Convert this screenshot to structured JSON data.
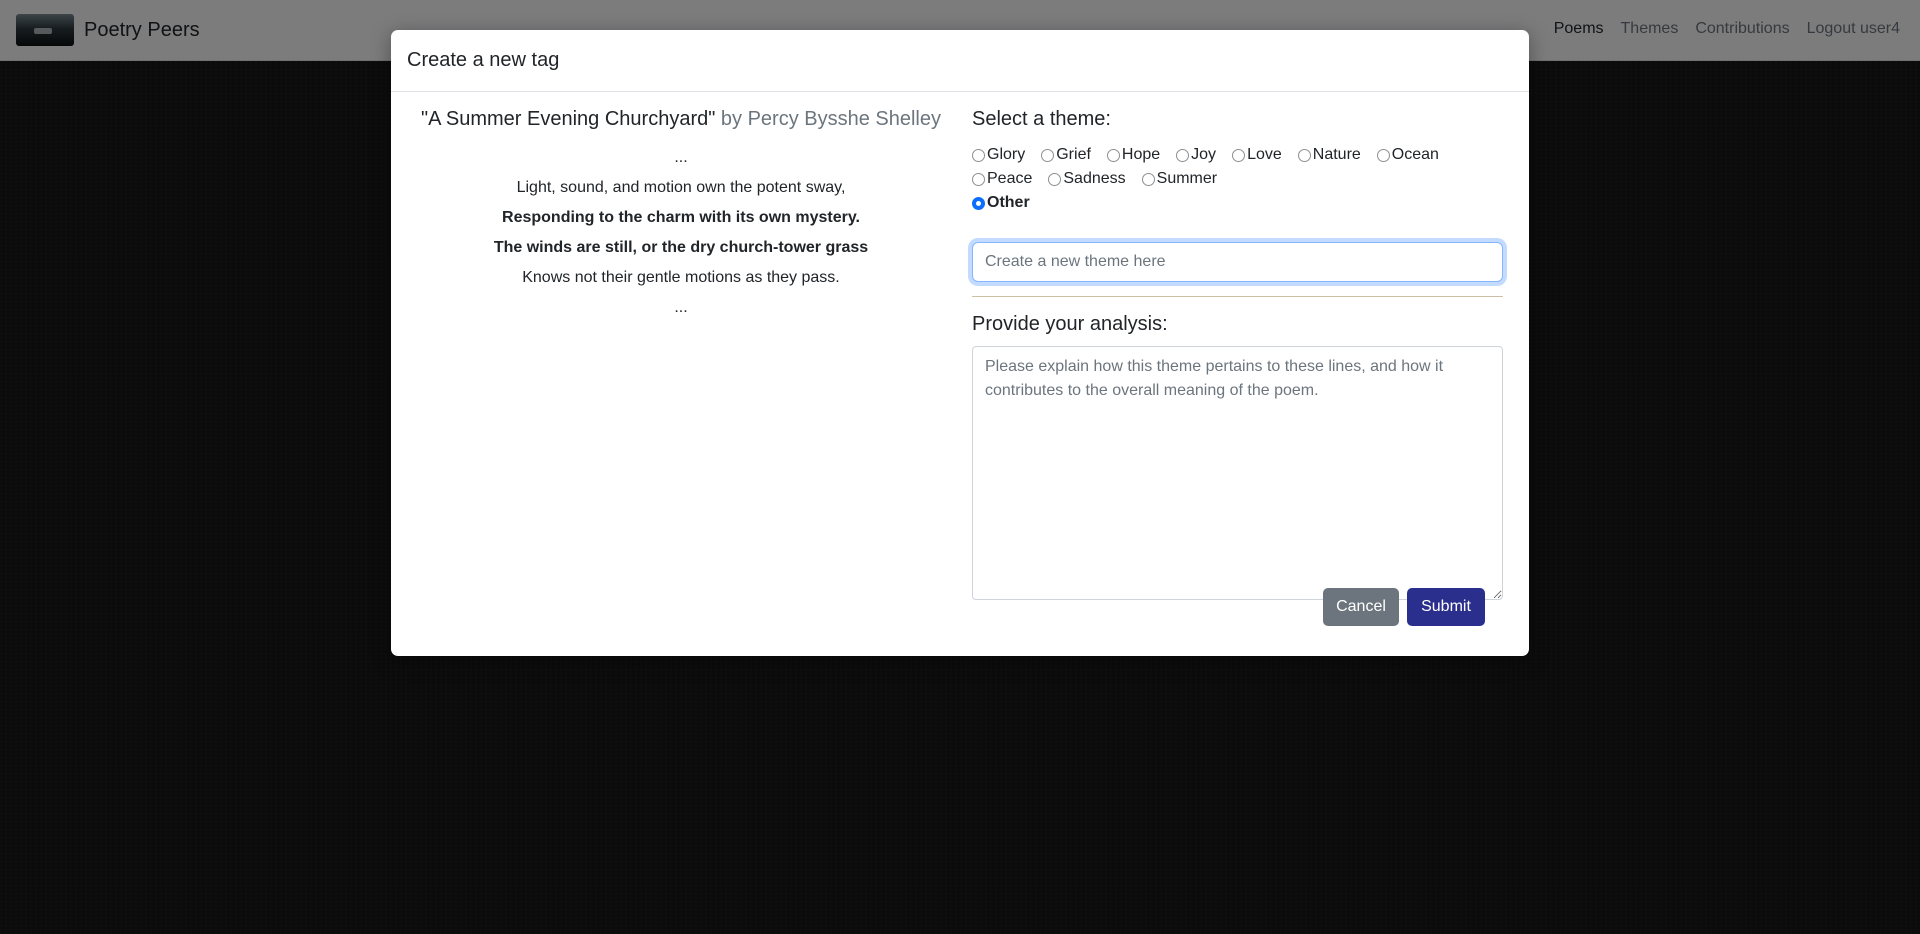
{
  "navbar": {
    "brand": "Poetry Peers",
    "links": [
      "Poems",
      "Themes",
      "Contributions",
      "Logout user4"
    ],
    "active_link": "Poems"
  },
  "modal": {
    "title": "Create a new tag",
    "poem": {
      "title": "\"A Summer Evening Churchyard\"",
      "author": "by Percy Bysshe Shelley",
      "ellipsis_top": "...",
      "lines": [
        "Light, sound, and motion own the potent sway,",
        "Responding to the charm with its own mystery.",
        "The winds are still, or the dry church-tower grass",
        "Knows not their gentle motions as they pass."
      ],
      "bold_lines": [
        1,
        2
      ],
      "ellipsis_bottom": "..."
    },
    "theme_section": {
      "label": "Select a theme:",
      "options": [
        "Glory",
        "Grief",
        "Hope",
        "Joy",
        "Love",
        "Nature",
        "Ocean",
        "Peace",
        "Sadness",
        "Summer"
      ],
      "other_label": "Other",
      "selected": "Other",
      "new_theme_placeholder": "Create a new theme here",
      "new_theme_value": ""
    },
    "analysis_section": {
      "label": "Provide your analysis:",
      "placeholder": "Please explain how this theme pertains to these lines, and how it contributes to the overall meaning of the poem.",
      "value": ""
    },
    "buttons": {
      "cancel": "Cancel",
      "submit": "Submit"
    }
  },
  "colors": {
    "primary_button": "#2a2e8c",
    "secondary_button": "#6c757d",
    "radio_checked": "#0d6efd",
    "navbar_bg": "#f8f9fa"
  }
}
